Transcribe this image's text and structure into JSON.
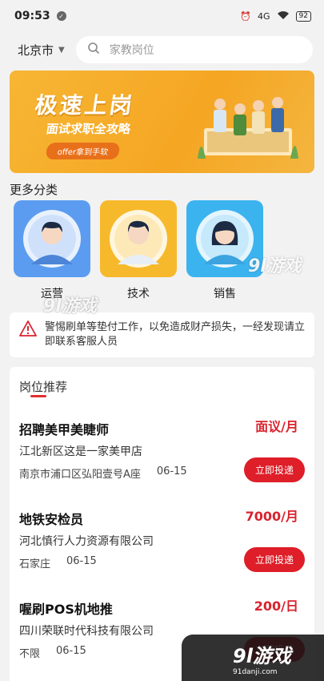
{
  "status_bar": {
    "time": "09:53",
    "network": "4G",
    "battery": "92"
  },
  "search": {
    "city": "北京市",
    "placeholder": "家教岗位"
  },
  "banner": {
    "title": "极速上岗",
    "subtitle": "面试求职全攻略",
    "tag": "offer拿到手软"
  },
  "categories": {
    "title": "更多分类",
    "items": [
      {
        "label": "运营",
        "color": "#5b9cf0"
      },
      {
        "label": "技术",
        "color": "#f7b92c"
      },
      {
        "label": "销售",
        "color": "#3bb3ef"
      }
    ]
  },
  "notice": {
    "text": "警惕刷单等垫付工作，以免造成财产损失，一经发现请立即联系客服人员"
  },
  "jobs": {
    "title": "岗位推荐",
    "apply_label": "立即投递",
    "items": [
      {
        "title": "招聘美甲美睫师",
        "salary": "面议/月",
        "company": "江北新区这是一家美甲店",
        "location": "南京市浦口区弘阳壹号A座",
        "date": "06-15"
      },
      {
        "title": "地铁安检员",
        "salary": "7000/月",
        "company": "河北慎行人力资源有限公司",
        "location": "石家庄",
        "date": "06-15"
      },
      {
        "title": "喔刷POS机地推",
        "salary": "200/日",
        "company": "四川荣联时代科技有限公司",
        "location": "不限",
        "date": "06-15"
      }
    ]
  },
  "watermark": {
    "brand": "9l游戏",
    "domain": "91danji.com"
  },
  "colors": {
    "accent": "#de1e28",
    "banner": "#f5a623"
  }
}
